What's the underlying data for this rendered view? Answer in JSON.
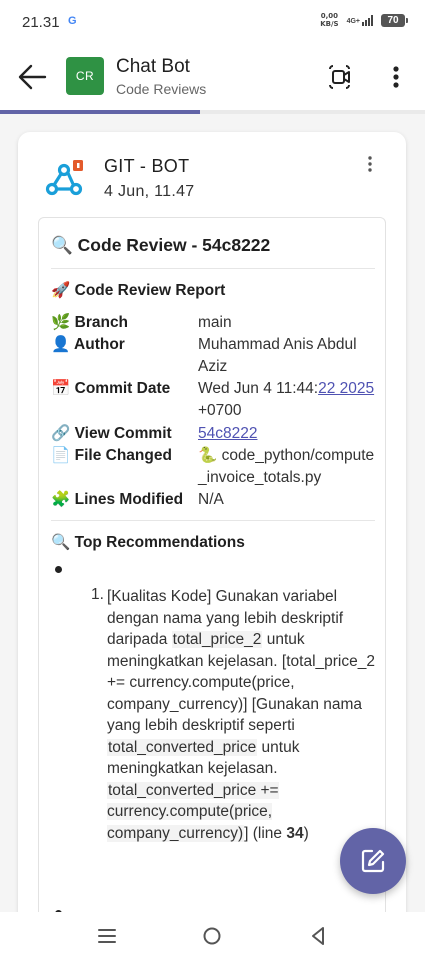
{
  "status_bar": {
    "time": "21.31",
    "google_icon": "G",
    "speed_value": "0,00",
    "speed_unit": "KB/S",
    "network": "4G+",
    "battery": "70"
  },
  "header": {
    "avatar_initials": "CR",
    "title": "Chat Bot",
    "subtitle": "Code Reviews",
    "icons": [
      "back-arrow-icon",
      "video-call-icon",
      "more-vertical-icon"
    ]
  },
  "tab_indicator_fraction": 0.47,
  "message": {
    "sender": "GIT - BOT",
    "time": "4 Jun, 11.47",
    "card": {
      "title_emoji": "🔍",
      "title": "Code Review - 54c8222",
      "report_emoji": "🚀",
      "report_title": "Code Review Report",
      "fields": {
        "branch": {
          "emoji": "🌿",
          "label": "Branch",
          "value": "main"
        },
        "author": {
          "emoji": "👤",
          "label": "Author",
          "value": "Muhammad Anis Abdul Aziz"
        },
        "commit_date": {
          "emoji": "📅",
          "label": "Commit Date",
          "value_prefix": "Wed Jun 4 11:44:",
          "value_link": "22 2025",
          "value_suffix": " +0700"
        },
        "view_commit": {
          "emoji": "🔗",
          "label": "View Commit",
          "link": "54c8222"
        },
        "file_changed": {
          "emoji": "📄",
          "label": "File Changed",
          "file_emoji": "🐍",
          "value": "code_python/compute_invoice_totals.py"
        },
        "lines_modified": {
          "emoji": "🧩",
          "label": "Lines Modified",
          "value": "N/A"
        }
      },
      "recommendations": {
        "emoji": "🔍",
        "title": "Top Recommendations",
        "item_number": "1.",
        "text_1": "[Kualitas Kode] Gunakan variabel dengan nama yang lebih deskriptif daripada ",
        "code_1": "total_price_2",
        "text_2": " untuk meningkatkan kejelasan. [total_price_2 += currency.compute(price, company_currency)] [Gunakan nama yang lebih deskriptif seperti ",
        "code_2": "total_converted_price",
        "text_3": " untuk meningkatkan kejelasan. ",
        "code_3": "total_converted_price += currency.compute(price, company_currency)",
        "text_4": "] (line ",
        "line": "34",
        "text_5": ")"
      }
    }
  },
  "colors": {
    "accent": "#6264a7",
    "avatar": "#2f9244",
    "link": "#4f52b2",
    "bot_icon": "#1a9fd9"
  },
  "fab_icon": "compose-icon",
  "nav": [
    "recent-apps-icon",
    "home-icon",
    "back-triangle-icon"
  ]
}
